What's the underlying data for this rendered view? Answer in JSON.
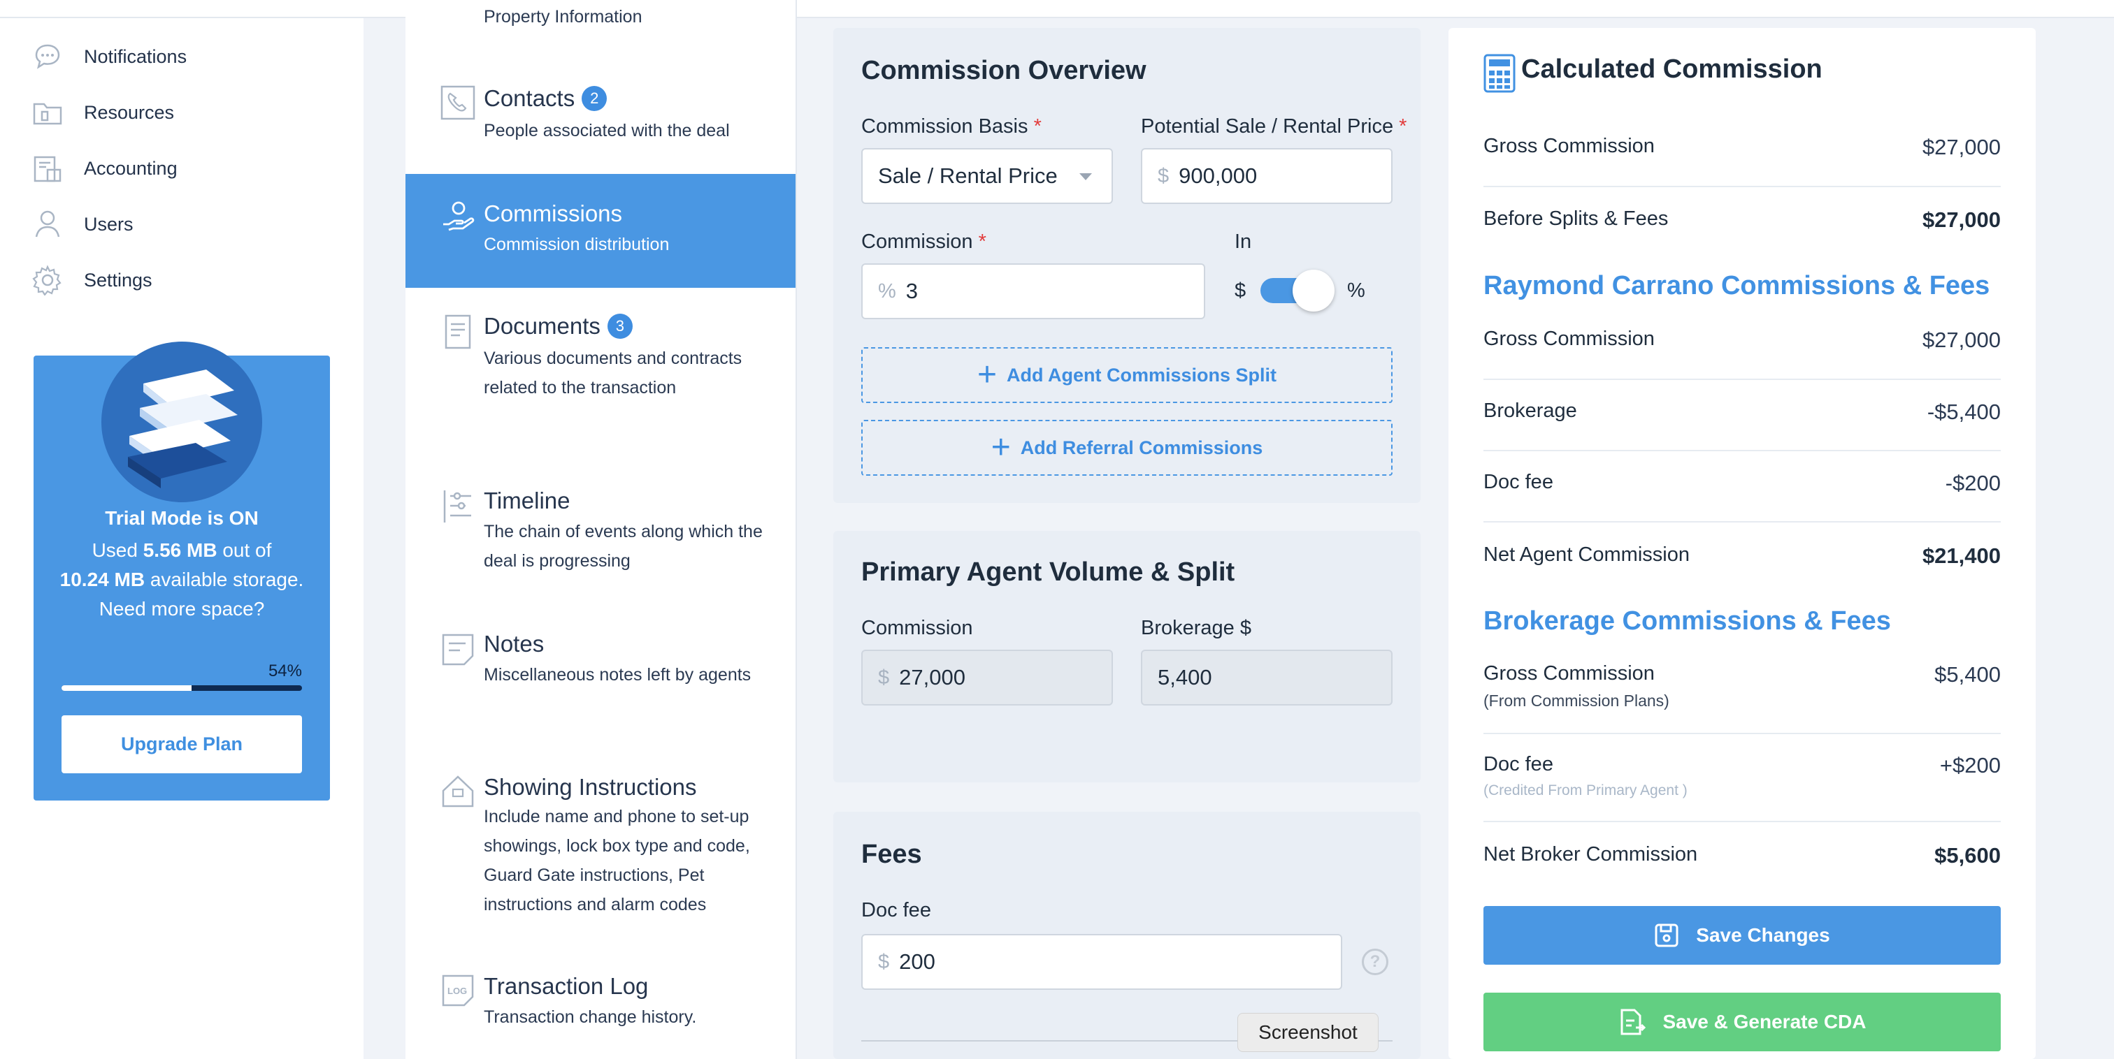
{
  "sidebar": {
    "items": [
      {
        "label": "Notifications",
        "icon": "chat-bubble-icon"
      },
      {
        "label": "Resources",
        "icon": "folder-icon"
      },
      {
        "label": "Accounting",
        "icon": "ledger-icon"
      },
      {
        "label": "Users",
        "icon": "user-icon"
      },
      {
        "label": "Settings",
        "icon": "gear-icon"
      }
    ],
    "trial": {
      "title": "Trial Mode is ON",
      "used_prefix": "Used ",
      "used": "5.56 MB",
      "used_mid": " out of",
      "total": "10.24 MB",
      "total_suffix": " available storage.",
      "need_more": "Need more space?",
      "percent_label": "54%",
      "percent": 54,
      "upgrade_label": "Upgrade Plan"
    }
  },
  "sections": {
    "property_partial": "Property Information",
    "contacts": {
      "title": "Contacts",
      "badge": "2",
      "desc": "People associated with the deal"
    },
    "commissions": {
      "title": "Commissions",
      "desc": "Commission distribution"
    },
    "documents": {
      "title": "Documents",
      "badge": "3",
      "desc": "Various documents and contracts related to the transaction"
    },
    "timeline": {
      "title": "Timeline",
      "desc": "The chain of events along which the deal is progressing"
    },
    "notes": {
      "title": "Notes",
      "desc": "Miscellaneous notes left by agents"
    },
    "showing": {
      "title": "Showing Instructions",
      "desc": "Include name and phone to set-up showings, lock box type and code, Guard Gate instructions, Pet instructions and alarm codes"
    },
    "log": {
      "title": "Transaction Log",
      "desc": "Transaction change history."
    }
  },
  "overview": {
    "title": "Commission Overview",
    "basis_label": "Commission Basis",
    "basis_value": "Sale / Rental Price",
    "price_label": "Potential Sale / Rental Price",
    "price_prefix": "$",
    "price_value": "900,000",
    "commission_label": "Commission",
    "commission_prefix": "%",
    "commission_value": "3",
    "in_label": "In",
    "toggle_left": "$",
    "toggle_right": "%",
    "add_split": "Add Agent Commissions Split",
    "add_referral": "Add Referral Commissions",
    "required_mark": "*",
    "plus_glyph": "+"
  },
  "primary": {
    "title": "Primary Agent Volume & Split",
    "commission_label": "Commission",
    "commission_prefix": "$",
    "commission_value": "27,000",
    "brokerage_label": "Brokerage $",
    "brokerage_value": "5,400"
  },
  "fees": {
    "title": "Fees",
    "doc_fee_label": "Doc fee",
    "doc_fee_prefix": "$",
    "doc_fee_value": "200",
    "help_glyph": "?"
  },
  "summary": {
    "title": "Calculated Commission",
    "gross_label": "Gross Commission",
    "gross_value": "$27,000",
    "before_label": "Before Splits & Fees",
    "before_value": "$27,000",
    "agent_group": "Raymond Carrano Commissions & Fees",
    "agent_gross_label": "Gross Commission",
    "agent_gross_value": "$27,000",
    "brokerage_label": "Brokerage",
    "brokerage_value": "-$5,400",
    "docfee_label": "Doc fee",
    "docfee_value": "-$200",
    "net_agent_label": "Net Agent Commission",
    "net_agent_value": "$21,400",
    "broker_group": "Brokerage Commissions & Fees",
    "b_gross_label": "Gross Commission",
    "b_gross_sub": "(From Commission Plans)",
    "b_gross_value": "$5,400",
    "b_docfee_label": "Doc fee",
    "b_docfee_sub": "(Credited From Primary Agent )",
    "b_docfee_value": "+$200",
    "net_broker_label": "Net Broker Commission",
    "net_broker_value": "$5,600",
    "save_label": "Save Changes",
    "save_cda_label": "Save & Generate CDA"
  },
  "tooltip": "Screenshot",
  "colors": {
    "accent": "#4a97e3",
    "green": "#62cf82",
    "required": "#e23b3b"
  }
}
